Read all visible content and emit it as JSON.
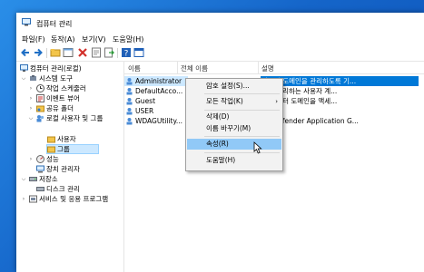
{
  "window": {
    "title": "컴퓨터 관리"
  },
  "menu": [
    "파일(F)",
    "동작(A)",
    "보기(V)",
    "도움말(H)"
  ],
  "toolbar": [
    "back-icon",
    "forward-icon",
    "up-folder-icon",
    "properties-icon",
    "delete-icon",
    "refresh-icon",
    "export-icon",
    "help-icon",
    "console-icon"
  ],
  "tree": {
    "root": "컴퓨터 관리(로컬)",
    "items": [
      {
        "label": "시스템 도구",
        "level": 1,
        "expand": "⌵"
      },
      {
        "label": "작업 스케줄러",
        "level": 2,
        "expand": "›"
      },
      {
        "label": "이벤트 뷰어",
        "level": 2,
        "expand": "›"
      },
      {
        "label": "공유 폴더",
        "level": 2,
        "expand": "›"
      },
      {
        "label": "로컬 사용자 및 그룹",
        "level": 2,
        "expand": "⌵"
      },
      {
        "label": "사용자",
        "level": 3,
        "expand": ""
      },
      {
        "label": "그룹",
        "level": 3,
        "expand": ""
      },
      {
        "label": "성능",
        "level": 2,
        "expand": "›"
      },
      {
        "label": "장치 관리자",
        "level": 2,
        "expand": ""
      },
      {
        "label": "저장소",
        "level": 1,
        "expand": "⌵"
      },
      {
        "label": "디스크 관리",
        "level": 2,
        "expand": ""
      },
      {
        "label": "서비스 및 응용 프로그램",
        "level": 1,
        "expand": "›"
      }
    ]
  },
  "list": {
    "columns": [
      "이름",
      "전체 이름",
      "설명"
    ],
    "rows": [
      {
        "name": "Administrator",
        "fullname": "",
        "desc": "컴퓨터/도메인을 관리하도록 기..."
      },
      {
        "name": "DefaultAcco...",
        "fullname": "",
        "desc": "에서 관리하는 사용자 계..."
      },
      {
        "name": "Guest",
        "fullname": "",
        "desc": "기 컴퓨터 도메인을 액세..."
      },
      {
        "name": "USER",
        "fullname": "",
        "desc": ""
      },
      {
        "name": "WDAGUtility...",
        "fullname": "",
        "desc": "ws Defender Application G..."
      }
    ]
  },
  "context_menu": {
    "items": [
      {
        "label": "암호 설정(S)...",
        "submenu": false
      },
      {
        "label": "모든 작업(K)",
        "submenu": true
      },
      {
        "label": "삭제(D)",
        "submenu": false
      },
      {
        "label": "이름 바꾸기(M)",
        "submenu": false
      },
      {
        "label": "속성(R)",
        "submenu": false,
        "hover": true
      },
      {
        "label": "도움말(H)",
        "submenu": false
      }
    ]
  },
  "colors": {
    "selection": "#0078d7",
    "hover": "#91c9f7",
    "desktop": "#1565c9"
  }
}
